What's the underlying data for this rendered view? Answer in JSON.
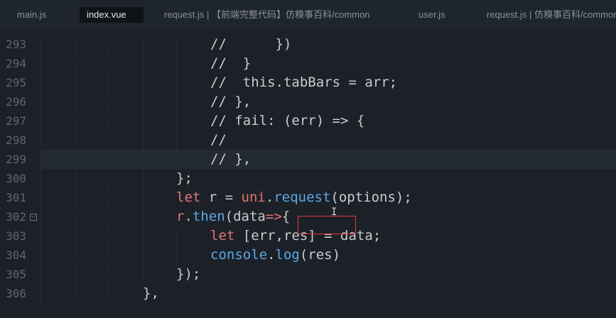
{
  "tabs": [
    {
      "label": "main.js",
      "active": false
    },
    {
      "label": "index.vue",
      "active": true
    },
    {
      "label": "request.js | 【前端完整代码】仿糗事百科/common",
      "active": false
    },
    {
      "label": "user.js",
      "active": false
    },
    {
      "label": "request.js | 仿糗事百科/common",
      "active": false
    }
  ],
  "editor": {
    "lines": [
      {
        "num": "293",
        "tokens": [
          {
            "t": "//      })",
            "c": "c"
          }
        ]
      },
      {
        "num": "294",
        "tokens": [
          {
            "t": "//  }",
            "c": "c"
          }
        ]
      },
      {
        "num": "295",
        "tokens": [
          {
            "t": "//  this.tabBars = arr;",
            "c": "c"
          }
        ]
      },
      {
        "num": "296",
        "tokens": [
          {
            "t": "// },",
            "c": "c"
          }
        ]
      },
      {
        "num": "297",
        "tokens": [
          {
            "t": "// fail: (err) => {",
            "c": "c"
          }
        ]
      },
      {
        "num": "298",
        "tokens": [
          {
            "t": "//",
            "c": "c"
          }
        ]
      },
      {
        "num": "299",
        "tokens": [
          {
            "t": "// },",
            "c": "c"
          }
        ]
      },
      {
        "num": "300",
        "tokens": [
          {
            "t": "};",
            "c": "p"
          }
        ]
      },
      {
        "num": "301",
        "tokens": [
          {
            "t": "let",
            "c": "kw"
          },
          {
            "t": " r = ",
            "c": "p"
          },
          {
            "t": "uni",
            "c": "fn"
          },
          {
            "t": ".",
            "c": "p"
          },
          {
            "t": "request",
            "c": "cs"
          },
          {
            "t": "(options);",
            "c": "p"
          }
        ]
      },
      {
        "num": "302",
        "tokens": [
          {
            "t": "r",
            "c": "fn"
          },
          {
            "t": ".",
            "c": "p"
          },
          {
            "t": "then",
            "c": "cs"
          },
          {
            "t": "(data",
            "c": "p"
          },
          {
            "t": "=>",
            "c": "kw"
          },
          {
            "t": "{",
            "c": "p"
          }
        ]
      },
      {
        "num": "303",
        "tokens": [
          {
            "t": "let",
            "c": "kw"
          },
          {
            "t": " [err,res] = data;",
            "c": "p"
          }
        ]
      },
      {
        "num": "304",
        "tokens": [
          {
            "t": "console",
            "c": "cs"
          },
          {
            "t": ".",
            "c": "p"
          },
          {
            "t": "log",
            "c": "cs"
          },
          {
            "t": "(res)",
            "c": "p"
          }
        ]
      },
      {
        "num": "305",
        "tokens": [
          {
            "t": "});",
            "c": "p"
          }
        ]
      },
      {
        "num": "306",
        "tokens": [
          {
            "t": "},",
            "c": "p"
          }
        ]
      }
    ]
  }
}
